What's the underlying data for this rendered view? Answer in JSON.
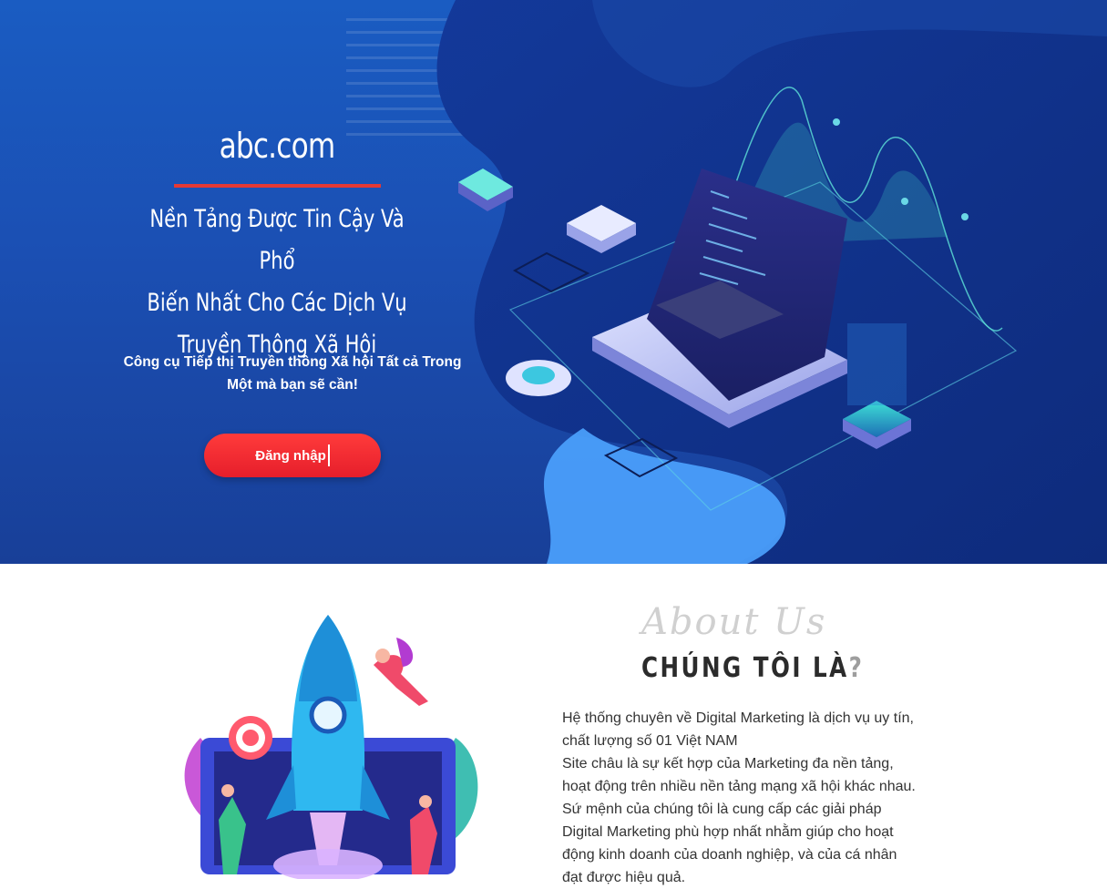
{
  "hero": {
    "site_title": "abc.com",
    "headline_lines": [
      "Nền Tảng Được Tin Cậy Và Phổ",
      "Biến Nhất Cho Các Dịch Vụ",
      "Truyền Thông Xã Hội"
    ],
    "subtext_lines": [
      "Công cụ Tiếp thị Truyền thông Xã hội Tất cả Trong",
      "Một mà bạn sẽ cần!"
    ],
    "login_label": "Đăng nhập",
    "colors": {
      "background": "#1b4fb3",
      "accent": "#e53935",
      "button": "#ff2d3a"
    }
  },
  "about": {
    "script_title": "About Us",
    "heading": "CHÚNG TÔI LÀ",
    "heading_mark": "?",
    "paragraph_lines": [
      "Hệ thống chuyên về Digital Marketing là dịch vụ uy tín,",
      "chất lượng số 01 Việt NAM",
      "Site châu là sự kết hợp của Marketing đa nền tảng,",
      "hoạt động trên nhiều nền tảng mạng xã hội khác nhau.",
      "Sứ mệnh của chúng tôi là cung cấp các giải pháp",
      "Digital Marketing phù hợp nhất nhằm giúp cho hoạt",
      "động kinh doanh của doanh nghiệp, và của cá nhân",
      "đạt được hiệu quả."
    ]
  },
  "icons": [
    "laptop-icon",
    "rocket-icon",
    "target-icon"
  ]
}
